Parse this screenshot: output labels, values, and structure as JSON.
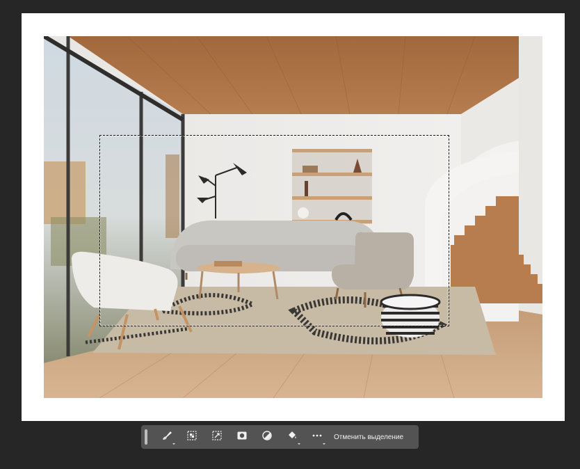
{
  "contextual_taskbar": {
    "tools": [
      {
        "icon": "brush-tool-icon",
        "has_submenu": true
      },
      {
        "icon": "select-subject-icon",
        "has_submenu": false
      },
      {
        "icon": "transform-selection-icon",
        "has_submenu": false
      },
      {
        "icon": "mask-icon",
        "has_submenu": false
      },
      {
        "icon": "adjustment-layer-icon",
        "has_submenu": false
      },
      {
        "icon": "fill-bucket-icon",
        "has_submenu": true
      },
      {
        "icon": "more-options-icon",
        "has_submenu": true
      }
    ],
    "deselect_label": "Отменить выделение"
  },
  "colors": {
    "workspace_bg": "#262626",
    "taskbar_bg": "#535353",
    "artboard_bg": "#ffffff"
  }
}
